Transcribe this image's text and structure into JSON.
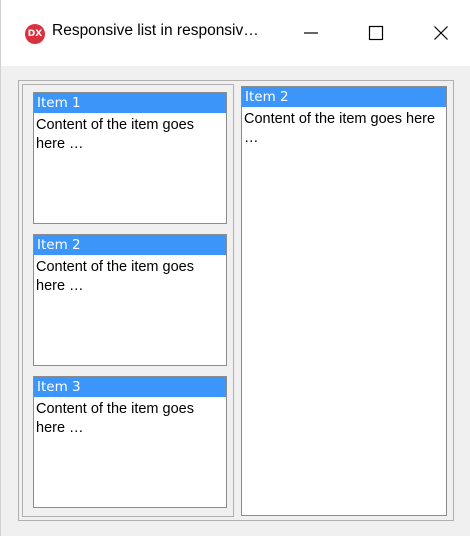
{
  "window": {
    "title": "Responsive list in responsiv…",
    "icon_label": "DX",
    "icon_color": "#d9323e"
  },
  "list": {
    "header_color": "#3c96fa",
    "items": [
      {
        "header": "Item 1",
        "content": "Content of the item goes here …"
      },
      {
        "header": "Item 2",
        "content": "Content of the item goes here …"
      },
      {
        "header": "Item 3",
        "content": "Content of the item goes here …"
      }
    ]
  },
  "detail": {
    "header": "Item 2",
    "content": "Content of the item goes here …"
  }
}
